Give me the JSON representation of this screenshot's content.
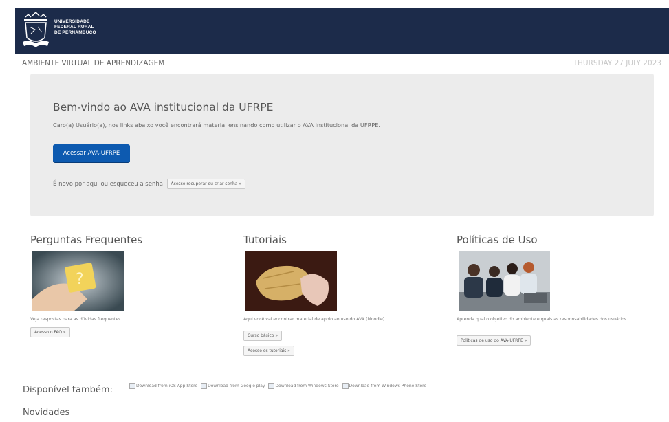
{
  "header": {
    "logo_lines": [
      "UNIVERSIDADE",
      "FEDERAL RURAL",
      "DE PERNAMBUCO"
    ]
  },
  "subbar": {
    "site_title": "AMBIENTE VIRTUAL DE APRENDIZAGEM",
    "date": "THURSDAY 27 JULY 2023"
  },
  "hero": {
    "title": "Bem-vindo ao AVA institucional da UFRPE",
    "intro": "Caro(a) Usuário(a), nos links abaixo você encontrará material ensinando como utilizar o AVA institucional da UFRPE.",
    "primary_button": "Acessar AVA-UFRPE",
    "new_user_text": "É novo por aqui ou esqueceu a senha:",
    "recover_button": "Acesse recuperar ou criar senha »"
  },
  "columns": {
    "faq": {
      "title": "Perguntas Frequentes",
      "description": "Veja respostas para as dúvidas frequentes.",
      "button": "Acesso o FAQ »"
    },
    "tutorials": {
      "title": "Tutoriais",
      "description": "Aqui você vai encontrar material de apoio ao uso do AVA (Moodle).",
      "button_basic": "Curso básico »",
      "button_tutorials": "Acesse os tutoriais »"
    },
    "policies": {
      "title": "Políticas de Uso",
      "description": "Aprenda qual o objetivo do ambiente e quais as responsabilidades dos usuários.",
      "button": "Políticas de uso do AVA-UFRPE »"
    }
  },
  "available": {
    "label": "Disponível também:",
    "badges": [
      "Download from iOS App Store",
      "Download from Google play",
      "Download from Windows Store",
      "Download from Windows Phone Store"
    ]
  },
  "news": {
    "title": "Novidades"
  },
  "colors": {
    "header_bg": "#1c2b4a",
    "primary_button": "#0d5ab0",
    "hero_bg": "#ececec"
  }
}
